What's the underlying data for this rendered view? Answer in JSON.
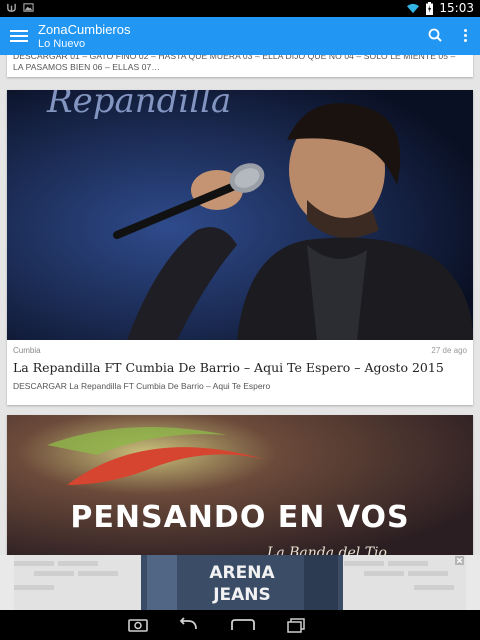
{
  "status": {
    "time": "15:03"
  },
  "appbar": {
    "title": "ZonaCumbieros",
    "subtitle": "Lo Nuevo"
  },
  "prev_post": {
    "excerpt": "DESCARGAR 01 – GATO FINO 02 – HASTA QUE MUERA 03 – ELLA DIJO QUE NO 04 – SOLO LE MIENTE 05 – LA PASAMOS BIEN 06 – ELLAS 07…"
  },
  "post": {
    "image_text": "Repandilla",
    "category": "Cumbia",
    "date": "27 de ago",
    "title": "La Repandilla FT Cumbia De Barrio – Aqui Te Espero – Agosto 2015",
    "excerpt": "DESCARGAR La Repandilla FT Cumbia De Barrio – Aqui Te Espero"
  },
  "next_post": {
    "image_text": "PENSANDO EN VOS",
    "image_subtext": "La Banda del Tio"
  },
  "ad": {
    "line1": "ARENA",
    "line2": "JEANS"
  },
  "colors": {
    "primary": "#2196f3",
    "statusbar": "#000000",
    "card": "#ffffff"
  },
  "icons": [
    "notification-icon",
    "image-icon",
    "wifi-icon",
    "battery-icon",
    "menu-icon",
    "search-icon",
    "more-vert-icon",
    "close-icon",
    "back-icon",
    "home-icon",
    "recents-icon",
    "screenshot-icon"
  ]
}
